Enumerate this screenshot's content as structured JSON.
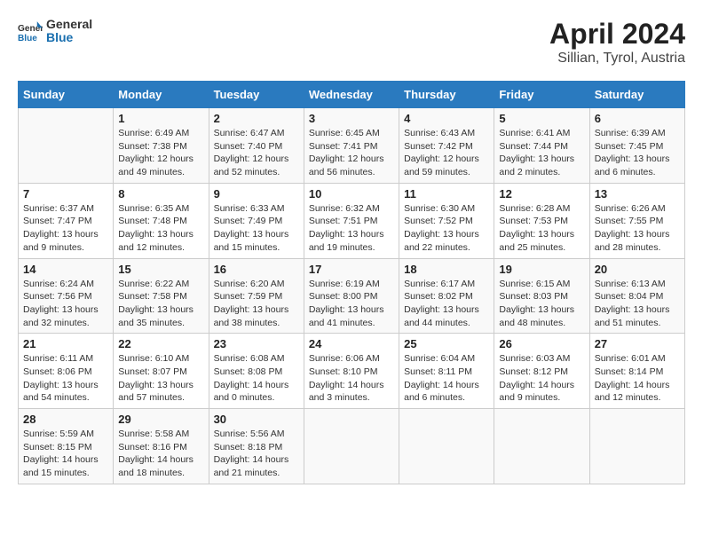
{
  "header": {
    "logo_line1": "General",
    "logo_line2": "Blue",
    "title": "April 2024",
    "subtitle": "Sillian, Tyrol, Austria"
  },
  "columns": [
    "Sunday",
    "Monday",
    "Tuesday",
    "Wednesday",
    "Thursday",
    "Friday",
    "Saturday"
  ],
  "rows": [
    [
      {
        "num": "",
        "text": ""
      },
      {
        "num": "1",
        "text": "Sunrise: 6:49 AM\nSunset: 7:38 PM\nDaylight: 12 hours\nand 49 minutes."
      },
      {
        "num": "2",
        "text": "Sunrise: 6:47 AM\nSunset: 7:40 PM\nDaylight: 12 hours\nand 52 minutes."
      },
      {
        "num": "3",
        "text": "Sunrise: 6:45 AM\nSunset: 7:41 PM\nDaylight: 12 hours\nand 56 minutes."
      },
      {
        "num": "4",
        "text": "Sunrise: 6:43 AM\nSunset: 7:42 PM\nDaylight: 12 hours\nand 59 minutes."
      },
      {
        "num": "5",
        "text": "Sunrise: 6:41 AM\nSunset: 7:44 PM\nDaylight: 13 hours\nand 2 minutes."
      },
      {
        "num": "6",
        "text": "Sunrise: 6:39 AM\nSunset: 7:45 PM\nDaylight: 13 hours\nand 6 minutes."
      }
    ],
    [
      {
        "num": "7",
        "text": "Sunrise: 6:37 AM\nSunset: 7:47 PM\nDaylight: 13 hours\nand 9 minutes."
      },
      {
        "num": "8",
        "text": "Sunrise: 6:35 AM\nSunset: 7:48 PM\nDaylight: 13 hours\nand 12 minutes."
      },
      {
        "num": "9",
        "text": "Sunrise: 6:33 AM\nSunset: 7:49 PM\nDaylight: 13 hours\nand 15 minutes."
      },
      {
        "num": "10",
        "text": "Sunrise: 6:32 AM\nSunset: 7:51 PM\nDaylight: 13 hours\nand 19 minutes."
      },
      {
        "num": "11",
        "text": "Sunrise: 6:30 AM\nSunset: 7:52 PM\nDaylight: 13 hours\nand 22 minutes."
      },
      {
        "num": "12",
        "text": "Sunrise: 6:28 AM\nSunset: 7:53 PM\nDaylight: 13 hours\nand 25 minutes."
      },
      {
        "num": "13",
        "text": "Sunrise: 6:26 AM\nSunset: 7:55 PM\nDaylight: 13 hours\nand 28 minutes."
      }
    ],
    [
      {
        "num": "14",
        "text": "Sunrise: 6:24 AM\nSunset: 7:56 PM\nDaylight: 13 hours\nand 32 minutes."
      },
      {
        "num": "15",
        "text": "Sunrise: 6:22 AM\nSunset: 7:58 PM\nDaylight: 13 hours\nand 35 minutes."
      },
      {
        "num": "16",
        "text": "Sunrise: 6:20 AM\nSunset: 7:59 PM\nDaylight: 13 hours\nand 38 minutes."
      },
      {
        "num": "17",
        "text": "Sunrise: 6:19 AM\nSunset: 8:00 PM\nDaylight: 13 hours\nand 41 minutes."
      },
      {
        "num": "18",
        "text": "Sunrise: 6:17 AM\nSunset: 8:02 PM\nDaylight: 13 hours\nand 44 minutes."
      },
      {
        "num": "19",
        "text": "Sunrise: 6:15 AM\nSunset: 8:03 PM\nDaylight: 13 hours\nand 48 minutes."
      },
      {
        "num": "20",
        "text": "Sunrise: 6:13 AM\nSunset: 8:04 PM\nDaylight: 13 hours\nand 51 minutes."
      }
    ],
    [
      {
        "num": "21",
        "text": "Sunrise: 6:11 AM\nSunset: 8:06 PM\nDaylight: 13 hours\nand 54 minutes."
      },
      {
        "num": "22",
        "text": "Sunrise: 6:10 AM\nSunset: 8:07 PM\nDaylight: 13 hours\nand 57 minutes."
      },
      {
        "num": "23",
        "text": "Sunrise: 6:08 AM\nSunset: 8:08 PM\nDaylight: 14 hours\nand 0 minutes."
      },
      {
        "num": "24",
        "text": "Sunrise: 6:06 AM\nSunset: 8:10 PM\nDaylight: 14 hours\nand 3 minutes."
      },
      {
        "num": "25",
        "text": "Sunrise: 6:04 AM\nSunset: 8:11 PM\nDaylight: 14 hours\nand 6 minutes."
      },
      {
        "num": "26",
        "text": "Sunrise: 6:03 AM\nSunset: 8:12 PM\nDaylight: 14 hours\nand 9 minutes."
      },
      {
        "num": "27",
        "text": "Sunrise: 6:01 AM\nSunset: 8:14 PM\nDaylight: 14 hours\nand 12 minutes."
      }
    ],
    [
      {
        "num": "28",
        "text": "Sunrise: 5:59 AM\nSunset: 8:15 PM\nDaylight: 14 hours\nand 15 minutes."
      },
      {
        "num": "29",
        "text": "Sunrise: 5:58 AM\nSunset: 8:16 PM\nDaylight: 14 hours\nand 18 minutes."
      },
      {
        "num": "30",
        "text": "Sunrise: 5:56 AM\nSunset: 8:18 PM\nDaylight: 14 hours\nand 21 minutes."
      },
      {
        "num": "",
        "text": ""
      },
      {
        "num": "",
        "text": ""
      },
      {
        "num": "",
        "text": ""
      },
      {
        "num": "",
        "text": ""
      }
    ]
  ]
}
